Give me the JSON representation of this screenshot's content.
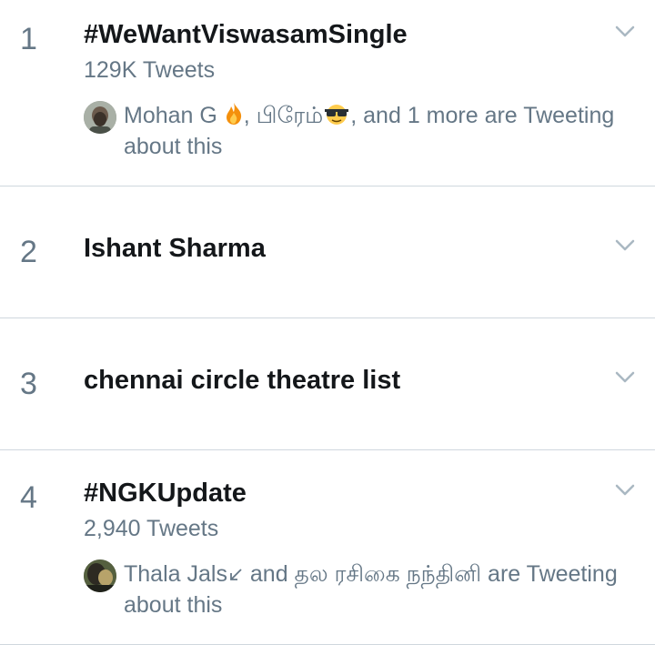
{
  "trends": [
    {
      "rank": "1",
      "title": "#WeWantViswasamSingle",
      "tweet_count": "129K Tweets",
      "tweeting": {
        "part1": "Mohan G ",
        "emoji1": "fire-emoji",
        "part2": ", பிரேம்",
        "emoji2": "sunglasses-emoji",
        "part3": ", and 1 more are Tweeting about this"
      }
    },
    {
      "rank": "2",
      "title": "Ishant Sharma"
    },
    {
      "rank": "3",
      "title": "chennai circle theatre list"
    },
    {
      "rank": "4",
      "title": "#NGKUpdate",
      "tweet_count": "2,940 Tweets",
      "tweeting": {
        "part1": "Thala Jals",
        "emoji1": "arrow-down-left-emoji",
        "part2": " and தல ரசிகை நந்தினி are Tweeting about this"
      }
    }
  ],
  "colors": {
    "text_primary": "#14171a",
    "text_secondary": "#657786",
    "divider": "#cfd7de",
    "chevron": "#aab8c2"
  }
}
